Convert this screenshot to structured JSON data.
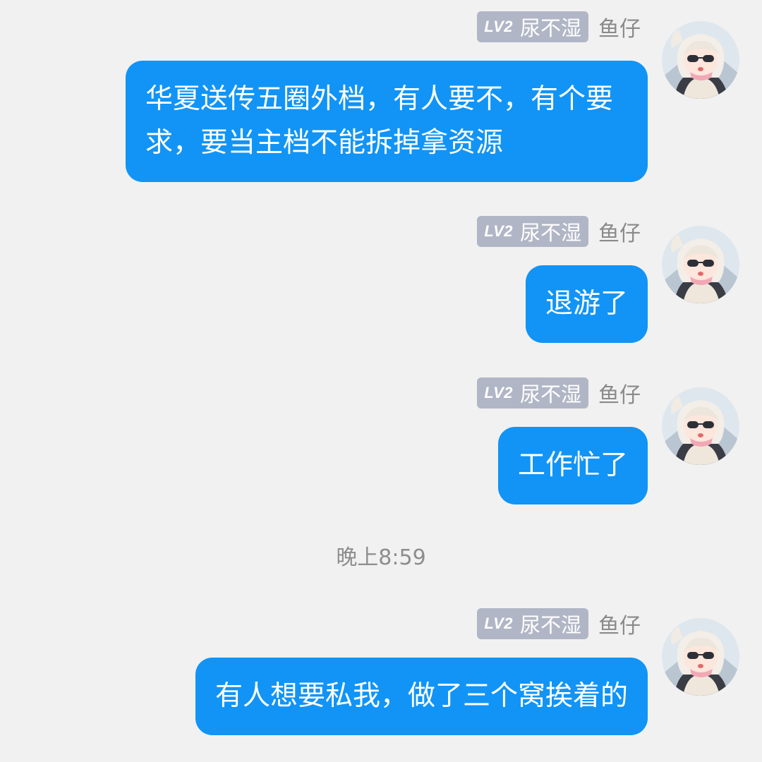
{
  "messages": [
    {
      "level": "LV2",
      "title": "尿不湿",
      "username": "鱼仔",
      "text": "华夏送传五圈外档，有人要不，有个要求，要当主档不能拆掉拿资源"
    },
    {
      "level": "LV2",
      "title": "尿不湿",
      "username": "鱼仔",
      "text": "退游了"
    },
    {
      "level": "LV2",
      "title": "尿不湿",
      "username": "鱼仔",
      "text": "工作忙了"
    },
    {
      "level": "LV2",
      "title": "尿不湿",
      "username": "鱼仔",
      "text": "有人想要私我，做了三个窝挨着的"
    }
  ],
  "timestamp": "晚上8:59",
  "colors": {
    "bubble": "#1194f6",
    "level_badge": "#b1b6c6",
    "background": "#f1f1f1"
  },
  "icons": {
    "avatar": "anime-girl-sunglasses-avatar"
  }
}
